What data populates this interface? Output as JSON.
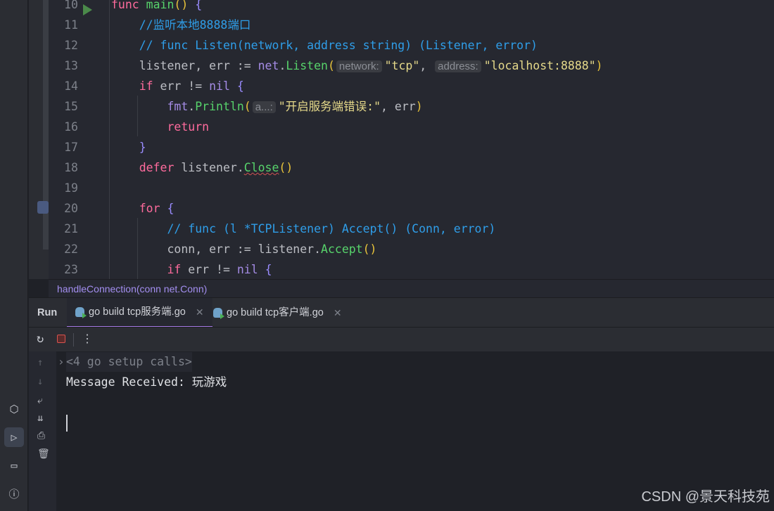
{
  "editor": {
    "lines": [
      {
        "n": "10",
        "tokens": [
          [
            "kw",
            "func "
          ],
          [
            "fn",
            "main"
          ],
          [
            "par",
            "()"
          ],
          [
            "",
            " "
          ],
          [
            "br",
            "{"
          ]
        ]
      },
      {
        "n": "11",
        "tokens": [
          [
            "cm",
            "    //监听本地8888端口"
          ]
        ]
      },
      {
        "n": "12",
        "tokens": [
          [
            "cm",
            "    // func Listen(network, address string) (Listener, error)"
          ]
        ]
      },
      {
        "n": "13",
        "tokens": [
          [
            "",
            "    listener, err := "
          ],
          [
            "pk",
            "net"
          ],
          [
            "",
            "."
          ],
          [
            "fn",
            "Listen"
          ],
          [
            "par",
            "("
          ],
          [
            "hint",
            "network:"
          ],
          [
            "str",
            "\"tcp\""
          ],
          [
            "",
            ", "
          ],
          [
            "hint",
            "address:"
          ],
          [
            "str",
            "\"localhost:8888\""
          ],
          [
            "par",
            ")"
          ]
        ]
      },
      {
        "n": "14",
        "tokens": [
          [
            "kw",
            "    if "
          ],
          [
            "",
            "err != "
          ],
          [
            "pk",
            "nil "
          ],
          [
            "br",
            "{"
          ]
        ]
      },
      {
        "n": "15",
        "tokens": [
          [
            "",
            "        "
          ],
          [
            "pk",
            "fmt"
          ],
          [
            "",
            "."
          ],
          [
            "fn",
            "Println"
          ],
          [
            "par",
            "("
          ],
          [
            "hint",
            "a...:"
          ],
          [
            "str",
            "\"开启服务端错误:\""
          ],
          [
            "",
            ", err"
          ],
          [
            "par",
            ")"
          ]
        ]
      },
      {
        "n": "16",
        "tokens": [
          [
            "kw",
            "        return"
          ]
        ]
      },
      {
        "n": "17",
        "tokens": [
          [
            "br",
            "    }"
          ]
        ]
      },
      {
        "n": "18",
        "tokens": [
          [
            "kw",
            "    defer "
          ],
          [
            "",
            "listener."
          ],
          [
            "fn squig",
            "Close"
          ],
          [
            "par",
            "()"
          ]
        ]
      },
      {
        "n": "19",
        "tokens": []
      },
      {
        "n": "20",
        "tokens": [
          [
            "kw",
            "    for "
          ],
          [
            "br",
            "{"
          ]
        ]
      },
      {
        "n": "21",
        "tokens": [
          [
            "cm",
            "        // func (l *TCPListener) Accept() (Conn, error)"
          ]
        ]
      },
      {
        "n": "22",
        "tokens": [
          [
            "",
            "        conn, err := listener."
          ],
          [
            "fn",
            "Accept"
          ],
          [
            "par",
            "()"
          ]
        ]
      },
      {
        "n": "23",
        "tokens": [
          [
            "kw",
            "        if "
          ],
          [
            "",
            "err != "
          ],
          [
            "pk",
            "nil "
          ],
          [
            "br",
            "{"
          ]
        ]
      }
    ]
  },
  "breadcrumb": "handleConnection(conn net.Conn)",
  "run": {
    "label": "Run",
    "tabs": [
      {
        "label": "go build tcp服务端.go",
        "selected": true
      },
      {
        "label": "go build tcp客户端.go",
        "selected": false
      }
    ]
  },
  "console": {
    "setup": "<4 go setup calls>",
    "output": "Message Received: 玩游戏"
  },
  "watermark": "CSDN @景天科技苑"
}
